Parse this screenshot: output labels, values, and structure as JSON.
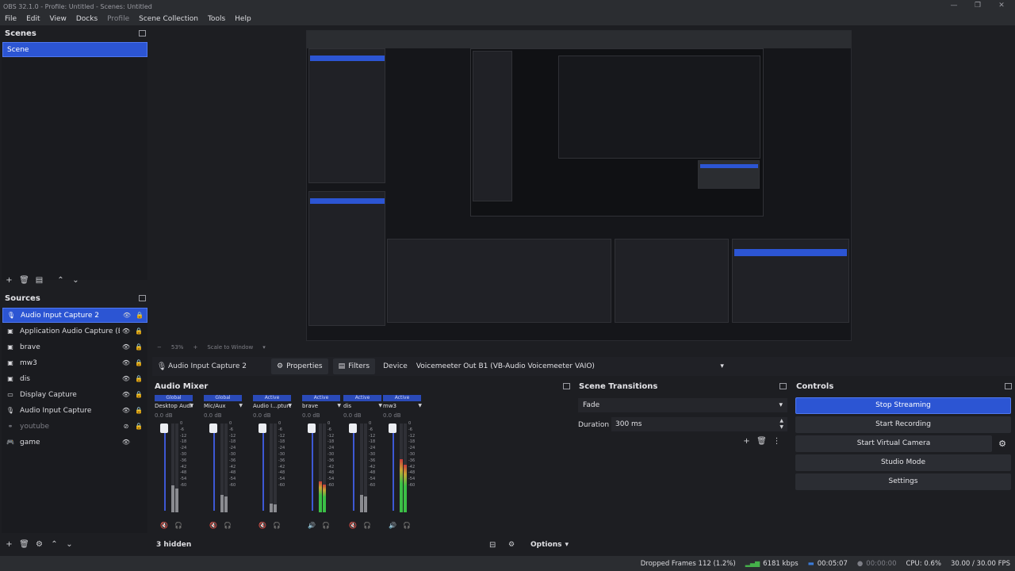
{
  "window": {
    "title": "OBS 32.1.0 - Profile: Untitled - Scenes: Untitled",
    "minimize": "—",
    "restore": "❐",
    "close": "✕"
  },
  "menu": [
    {
      "label": "File"
    },
    {
      "label": "Edit"
    },
    {
      "label": "View"
    },
    {
      "label": "Docks"
    },
    {
      "label": "Profile"
    },
    {
      "label": "Scene Collection"
    },
    {
      "label": "Tools"
    },
    {
      "label": "Help"
    }
  ],
  "scenes": {
    "title": "Scenes",
    "items": [
      {
        "label": "Scene"
      }
    ]
  },
  "sources": {
    "title": "Sources",
    "items": [
      {
        "label": "Audio Input Capture 2",
        "icon": "mic-icon"
      },
      {
        "label": "Application Audio Capture (BETA)",
        "icon": "app-audio-icon"
      },
      {
        "label": "brave",
        "icon": "window-icon"
      },
      {
        "label": "mw3",
        "icon": "window-icon"
      },
      {
        "label": "dis",
        "icon": "window-icon"
      },
      {
        "label": "Display Capture",
        "icon": "monitor-icon"
      },
      {
        "label": "Audio Input Capture",
        "icon": "mic-icon"
      },
      {
        "label": "youtube",
        "icon": "link-icon"
      },
      {
        "label": "game",
        "icon": "gamepad-icon"
      }
    ]
  },
  "preview_status": {
    "zoom": "53%",
    "scale_mode": "Scale to Window"
  },
  "context_bar": {
    "source": "Audio Input Capture 2",
    "properties": "Properties",
    "filters": "Filters",
    "device_label": "Device",
    "device_value": "Voicemeeter Out B1 (VB-Audio Voicemeeter VAIO)"
  },
  "mixer": {
    "title": "Audio Mixer",
    "hidden": "3 hidden",
    "options": "Options",
    "scale_ticks": [
      "0",
      "-6",
      "-12",
      "-18",
      "-24",
      "-30",
      "-36",
      "-42",
      "-48",
      "-54",
      "-60"
    ],
    "strips": [
      {
        "status": "Global",
        "name": "Desktop Audio",
        "db": "0.0 dB",
        "muted": true,
        "level": 0.3
      },
      {
        "status": "Global",
        "name": "Mic/Aux",
        "db": "0.0 dB",
        "muted": true,
        "level": 0.2
      },
      {
        "status": "Active",
        "name": "Audio I...pture 2",
        "db": "0.0 dB",
        "muted": true,
        "level": 0.1
      },
      {
        "status": "Active",
        "name": "brave",
        "db": "0.0 dB",
        "muted": false,
        "level": 0.35
      },
      {
        "status": "Active",
        "name": "dis",
        "db": "0.0 dB",
        "muted": true,
        "level": 0.2
      },
      {
        "status": "Active",
        "name": "mw3",
        "db": "0.0 dB",
        "muted": false,
        "level": 0.6
      }
    ]
  },
  "transitions": {
    "title": "Scene Transitions",
    "selected": "Fade",
    "duration_label": "Duration",
    "duration_value": "300 ms"
  },
  "controls": {
    "title": "Controls",
    "stop_streaming": "Stop Streaming",
    "start_recording": "Start Recording",
    "start_virtual_camera": "Start Virtual Camera",
    "studio_mode": "Studio Mode",
    "settings": "Settings"
  },
  "status": {
    "dropped_frames": "Dropped Frames 112 (1.2%)",
    "bitrate": "6181 kbps",
    "stream_time": "00:05:07",
    "record_time": "00:00:00",
    "cpu": "CPU: 0.6%",
    "fps": "30.00 / 30.00 FPS"
  },
  "colors": {
    "accent": "#2c55d3",
    "meter_green": "#3bbf46",
    "meter_yellow": "#c6a535",
    "meter_red": "#c83a3a",
    "mute_red": "#c03b3b"
  }
}
